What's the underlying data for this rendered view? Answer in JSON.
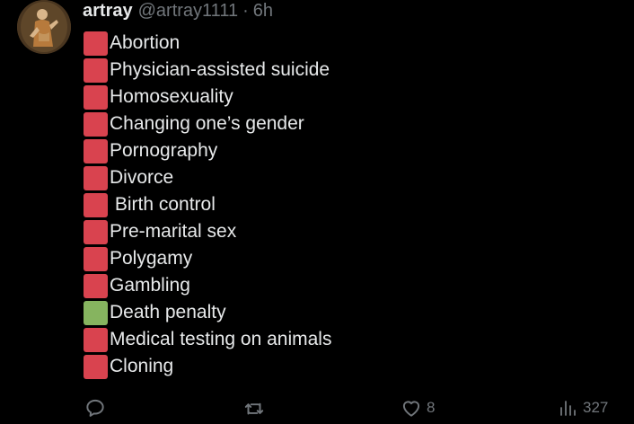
{
  "tweet": {
    "display_name": "artray",
    "handle": "@artray1111",
    "separator": "·",
    "time": "6h",
    "items": [
      {
        "label": "Abortion",
        "status": "red"
      },
      {
        "label": "Physician-assisted suicide",
        "status": "red"
      },
      {
        "label": "Homosexuality",
        "status": "red"
      },
      {
        "label": "Changing one’s gender",
        "status": "red"
      },
      {
        "label": "Pornography",
        "status": "red"
      },
      {
        "label": "Divorce",
        "status": "red"
      },
      {
        "label": " Birth control",
        "status": "red"
      },
      {
        "label": "Pre-marital sex",
        "status": "red"
      },
      {
        "label": "Polygamy",
        "status": "red"
      },
      {
        "label": "Gambling",
        "status": "red"
      },
      {
        "label": "Death penalty",
        "status": "green"
      },
      {
        "label": "Medical testing on animals",
        "status": "red"
      },
      {
        "label": "Cloning",
        "status": "red"
      }
    ],
    "colors": {
      "red_square": "#d9434f",
      "green_square": "#86b45f"
    }
  },
  "actions": {
    "reply": {
      "icon": "reply-icon"
    },
    "retweet": {
      "icon": "retweet-icon"
    },
    "like": {
      "icon": "heart-icon",
      "count": "8"
    },
    "views": {
      "icon": "views-chart-icon",
      "count": "327"
    }
  }
}
